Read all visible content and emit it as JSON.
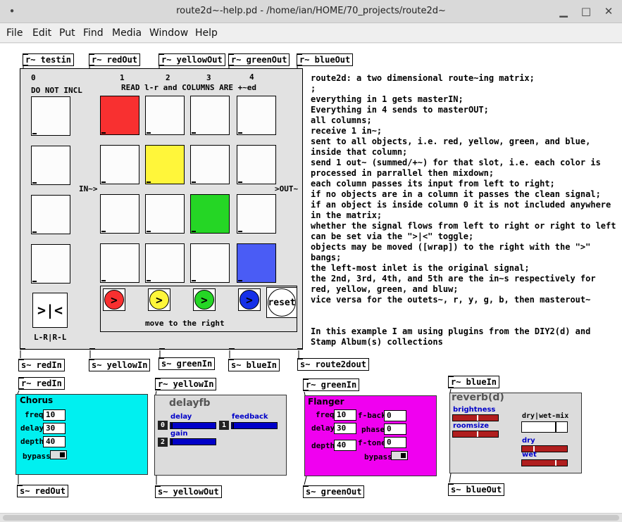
{
  "window": {
    "title": "route2d~-help.pd  - /home/ian/HOME/70_projects/route2d~",
    "close_glyph": "✕",
    "max_glyph": "□",
    "min_glyph": "▁",
    "pin_glyph": "•"
  },
  "menu": [
    "File",
    "Edit",
    "Put",
    "Find",
    "Media",
    "Window",
    "Help"
  ],
  "top_receives": [
    "r~ testin",
    "r~ redOut",
    "r~ yellowOut",
    "r~ greenOut",
    "r~ blueOut"
  ],
  "matrix": {
    "col_nums": [
      "0",
      "1",
      "2",
      "3",
      "4"
    ],
    "header_left": "DO NOT INCL",
    "header_right": "READ l-r and COLUMNS ARE +~ed",
    "in_label": "IN~>",
    "out_label": ">OUT~",
    "toggle_glyph": ">|<",
    "toggle_label": "L-R|R-L",
    "bang_glyph": ">",
    "reset_label": "reset",
    "move_label": "move to the right",
    "colors": {
      "red": "#f83030",
      "yellow": "#fff63a",
      "green": "#25d625",
      "blue": "#4a5cf5",
      "bg": "#e2e2e2"
    }
  },
  "bottom_sends": [
    "s~ redIn",
    "s~ yellowIn",
    "s~ greenIn",
    "s~ blueIn",
    "s~ route2dout"
  ],
  "comment_lines": [
    "route2d: a two dimensional route~ing matrix;",
    ";",
    "everything in 1 gets masterIN;",
    "Everything in 4 sends to masterOUT;",
    "all columns;",
    "receive 1 in~;",
    "sent to all objects, i.e. red, yellow, green, and blue,",
    "inside that column;",
    "send 1 out~ (summed/+~) for that slot, i.e. each color is",
    "processed in parrallel then mixdown;",
    "each column passes its input from left to right;",
    "if no objects are in a column it passes the clean signal;",
    "if an object is inside column 0 it is not included anywhere",
    "in the matrix;",
    "whether the signal flows from left to right or right to left",
    "can be set via the \">|<\" toggle;",
    "objects may be moved ([wrap]) to the right with the \">\"",
    "bangs;",
    "the left-most inlet is the original signal;",
    "the 2nd, 3rd, 4th, and 5th are the in~s respectively for",
    "red, yellow, green, and bluw;",
    "vice versa for the outets~, r, y, g, b, then masterout~",
    "",
    "",
    "In this example I am using plugins from the DIY2(d) and",
    "Stamp Album(s) collections"
  ],
  "plugins": {
    "chorus": {
      "recv": "r~ redIn",
      "send": "s~ redOut",
      "title": "Chorus",
      "bg": "#00f0f0",
      "params": [
        {
          "label": "freq",
          "value": "10"
        },
        {
          "label": "delay",
          "value": "30"
        },
        {
          "label": "depth",
          "value": "40"
        }
      ],
      "bypass": "bypass"
    },
    "delayfb": {
      "recv": "r~ yellowIn",
      "send": "s~ yellowOut",
      "title": "delayfb",
      "delay_label": "delay",
      "feedback_label": "feedback",
      "gain_label": "gain",
      "delay_num": "0",
      "feedback_num": "1",
      "gain_num": "2",
      "delay_level": 0.02,
      "feedback_level": 0.02,
      "gain_level": 0.02,
      "slider_color": "#0000c8"
    },
    "flanger": {
      "recv": "r~ greenIn",
      "send": "s~ greenOut",
      "title": "Flanger",
      "bg": "#f000f0",
      "params": [
        {
          "label": "freq",
          "value": "10"
        },
        {
          "label": "delay",
          "value": "30"
        },
        {
          "label": "depth",
          "value": "40"
        }
      ],
      "params2": [
        {
          "label": "f-back",
          "value": "0"
        },
        {
          "label": "phase",
          "value": "0"
        },
        {
          "label": "f-tone",
          "value": "0"
        }
      ],
      "bypass": "bypass"
    },
    "reverb": {
      "recv": "r~ blueIn",
      "send": "s~ blueOut",
      "title": "reverb(d)",
      "brightness_label": "brightness",
      "roomsize_label": "roomsize",
      "drywet_label": "dry|wet-mix",
      "dry_label": "dry",
      "wet_label": "wet",
      "slider_color": "#b01e1e",
      "brightness_level": 0.55,
      "roomsize_level": 0.55,
      "drywet_level": 0.75,
      "dry_level": 0.25,
      "wet_level": 0.75
    }
  }
}
